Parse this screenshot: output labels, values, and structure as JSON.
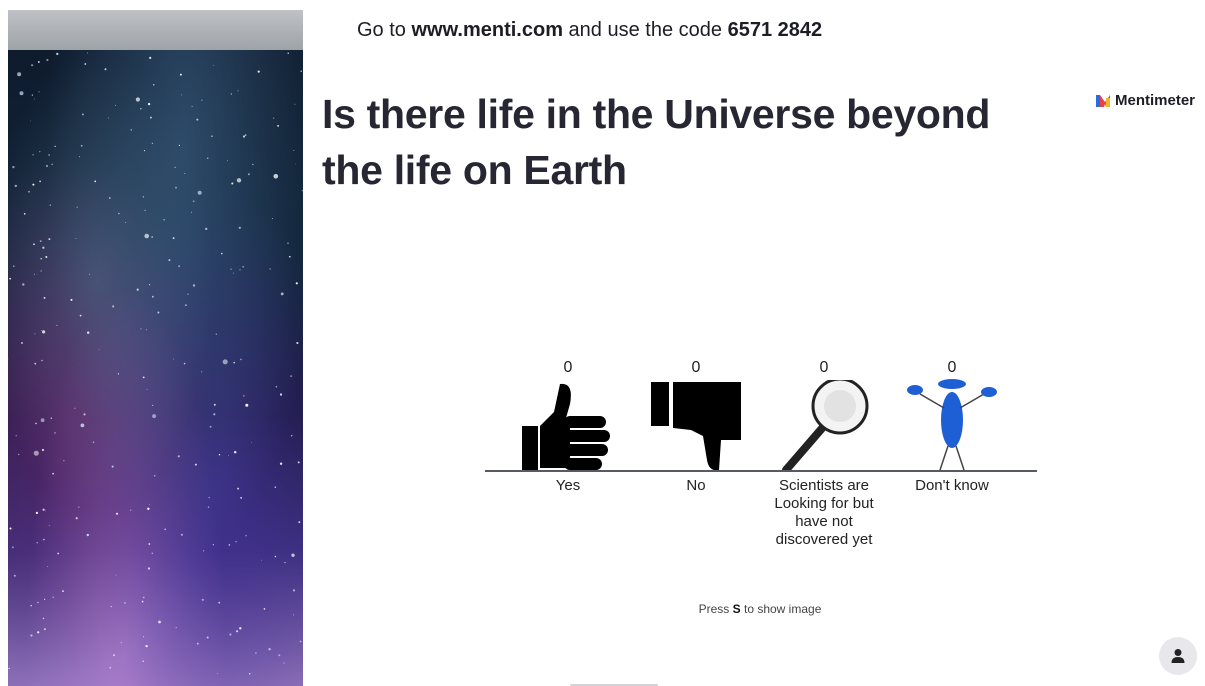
{
  "header": {
    "prefix": "Go to ",
    "url": "www.menti.com",
    "middle": " and use the code ",
    "code": "6571 2842"
  },
  "question": {
    "title": "Is there life in the Universe beyond the life on Earth"
  },
  "brand": {
    "name": "Mentimeter"
  },
  "chart_data": {
    "type": "bar",
    "categories": [
      "Yes",
      "No",
      "Scientists are Looking for but have not discovered yet",
      "Don't know"
    ],
    "values": [
      0,
      0,
      0,
      0
    ]
  },
  "results": [
    {
      "label": "Yes",
      "count": "0",
      "icon": "thumbs-up-icon"
    },
    {
      "label": "No",
      "count": "0",
      "icon": "thumbs-down-icon"
    },
    {
      "label": "Scientists are Looking for but have not discovered yet",
      "count": "0",
      "icon": "magnifying-glass-icon"
    },
    {
      "label": "Don't know",
      "count": "0",
      "icon": "shrugging-figure-icon"
    }
  ],
  "hint": {
    "prefix": "Press ",
    "key": "S",
    "suffix": " to show image"
  },
  "colors": {
    "accent_blue": "#1f5fd6",
    "brand_red": "#e6424a",
    "brand_blue": "#2a6be0"
  }
}
